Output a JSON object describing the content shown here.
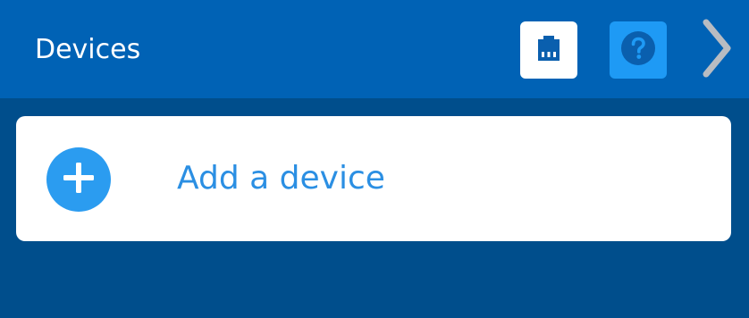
{
  "header": {
    "title": "Devices",
    "background": "#0062b5",
    "ethernet_icon": "ethernet-port-icon",
    "help_icon": "question-mark-icon",
    "next_icon": "chevron-right-icon"
  },
  "main": {
    "background": "#004e8c",
    "add_device": {
      "label": "Add a device",
      "icon": "plus-icon",
      "accent": "#2b9cf0"
    }
  }
}
